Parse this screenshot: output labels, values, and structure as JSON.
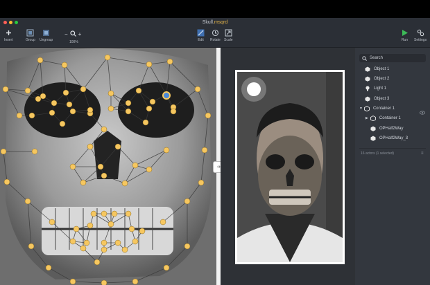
{
  "window": {
    "title_main": "Skull.",
    "title_ext": "msqrd",
    "colors": {
      "close": "#ff5f57",
      "minimize": "#febc2e",
      "zoom": "#28c840",
      "title_ext": "#e9b84a"
    }
  },
  "toolbar": {
    "insert_label": "Insert",
    "group_label": "Group",
    "ungroup_label": "Ungroup",
    "zoom_minus": "−",
    "zoom_plus": "+",
    "zoom_level": "100%",
    "edit_label": "Edit",
    "rotate_label": "Rotate",
    "scale_label": "Scale",
    "run_label": "Run",
    "settings_label": "Settings",
    "run_color": "#3dbb58"
  },
  "split_handle": {
    "label": "‹›"
  },
  "sidebar": {
    "search_placeholder": "Search",
    "items": [
      {
        "label": "Object 1",
        "icon": "cube-icon"
      },
      {
        "label": "Object 2",
        "icon": "cube-icon"
      },
      {
        "label": "Light 1",
        "icon": "bulb-icon"
      },
      {
        "label": "Object 3",
        "icon": "cube-icon"
      },
      {
        "label": "Container 1",
        "icon": "container-icon",
        "expanded": true,
        "visibility_icon": "eye-icon"
      },
      {
        "label": "Container 1",
        "icon": "container-icon",
        "expanded": false
      },
      {
        "label": "OPHalf2Way",
        "icon": "cube-icon"
      },
      {
        "label": "OPHalf2Way_3",
        "icon": "cube-icon"
      }
    ],
    "status": "16 actors (1 selected)"
  },
  "mesh": {
    "point_color": "#f6c760",
    "selected_color": "#4a88d8"
  }
}
